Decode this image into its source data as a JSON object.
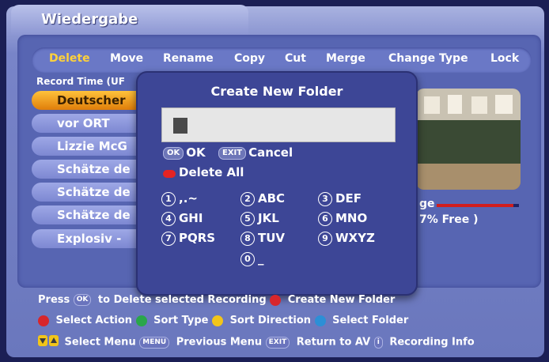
{
  "window": {
    "title": "Wiedergabe"
  },
  "actions": [
    "Delete",
    "Move",
    "Rename",
    "Copy",
    "Cut",
    "Merge",
    "Change Type",
    "Lock"
  ],
  "record_time_label": "Record Time (UF",
  "recordings": [
    "Deutscher",
    "vor ORT",
    "Lizzie McG",
    "Schätze de",
    "Schätze de",
    "Schätze de",
    "Explosiv -"
  ],
  "storage": {
    "label": "ge",
    "free_text": "7% Free )",
    "used_fraction": 0.93
  },
  "dialog": {
    "title": "Create New Folder",
    "input_value": "",
    "ok_key": "OK",
    "ok_label": "OK",
    "exit_key": "EXIT",
    "exit_label": "Cancel",
    "delete_all_label": "Delete All",
    "keypad": [
      {
        "num": "1",
        "chars": ",.~"
      },
      {
        "num": "2",
        "chars": "ABC"
      },
      {
        "num": "3",
        "chars": "DEF"
      },
      {
        "num": "4",
        "chars": "GHI"
      },
      {
        "num": "5",
        "chars": "JKL"
      },
      {
        "num": "6",
        "chars": "MNO"
      },
      {
        "num": "7",
        "chars": "PQRS"
      },
      {
        "num": "8",
        "chars": "TUV"
      },
      {
        "num": "9",
        "chars": "WXYZ"
      },
      {
        "num": "0",
        "chars": "_"
      }
    ]
  },
  "footer": {
    "press": "Press",
    "ok_key": "OK",
    "delete_text": "to Delete selected Recording",
    "create_text": "Create New Folder",
    "select_action": "Select Action",
    "sort_type": "Sort Type",
    "sort_direction": "Sort Direction",
    "select_folder": "Select Folder",
    "select_menu": "Select Menu",
    "menu_key": "MENU",
    "previous_menu": "Previous Menu",
    "exit_key": "EXIT",
    "return_to_av": "Return to AV",
    "info_key": "i",
    "recording_info": "Recording Info"
  },
  "colors": {
    "red": "#d8262b",
    "green": "#2aa64a",
    "yellow": "#f2c51a",
    "blue": "#2c8fd6",
    "highlight": "#f29a1b"
  }
}
